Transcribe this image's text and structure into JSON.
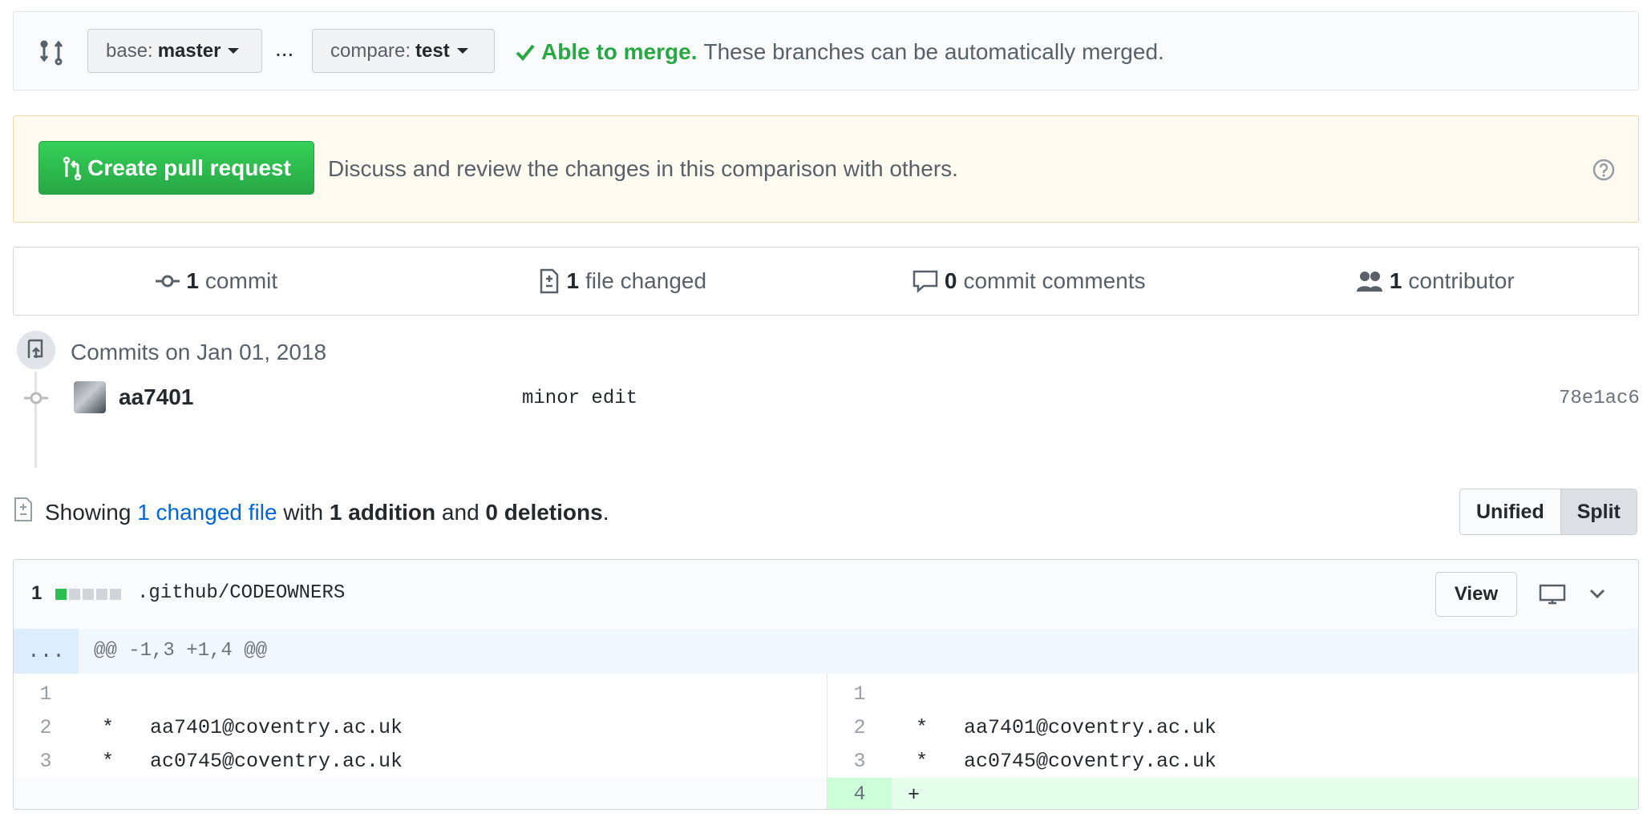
{
  "range": {
    "base_prefix": "base:",
    "base_branch": "master",
    "ellipsis": "...",
    "compare_prefix": "compare:",
    "compare_branch": "test",
    "merge_status": "Able to merge.",
    "merge_text": "These branches can be automatically merged."
  },
  "flash": {
    "create_pr": "Create pull request",
    "message": "Discuss and review the changes in this comparison with others."
  },
  "summary": {
    "commits_count": "1",
    "commits_label": "commit",
    "files_count": "1",
    "files_label": "file changed",
    "comments_count": "0",
    "comments_label": "commit comments",
    "contributors_count": "1",
    "contributors_label": "contributor"
  },
  "commits": {
    "group_title": "Commits on Jan 01, 2018",
    "items": [
      {
        "author": "aa7401",
        "message": "minor edit",
        "sha": "78e1ac6"
      }
    ]
  },
  "diffstat": {
    "showing": "Showing",
    "changed_link": "1 changed file",
    "with": "with",
    "additions": "1 addition",
    "and": "and",
    "deletions": "0 deletions",
    "period": ".",
    "unified": "Unified",
    "split": "Split"
  },
  "file": {
    "change_count": "1",
    "path": ".github/CODEOWNERS",
    "view_label": "View",
    "hunk_expand": "...",
    "hunk_header": "@@ -1,3 +1,4 @@",
    "left": [
      {
        "num": "1",
        "code": ""
      },
      {
        "num": "2",
        "code": "*   aa7401@coventry.ac.uk"
      },
      {
        "num": "3",
        "code": "*   ac0745@coventry.ac.uk"
      }
    ],
    "right": [
      {
        "num": "1",
        "code": ""
      },
      {
        "num": "2",
        "code": "*   aa7401@coventry.ac.uk"
      },
      {
        "num": "3",
        "code": "*   ac0745@coventry.ac.uk"
      },
      {
        "num": "4",
        "code": "+"
      }
    ]
  },
  "colors": {
    "success": "#28a745",
    "link": "#0366d6",
    "addition_bg": "#e6ffed",
    "addition_num_bg": "#cdffd8",
    "flash_bg": "#fffbf0"
  }
}
